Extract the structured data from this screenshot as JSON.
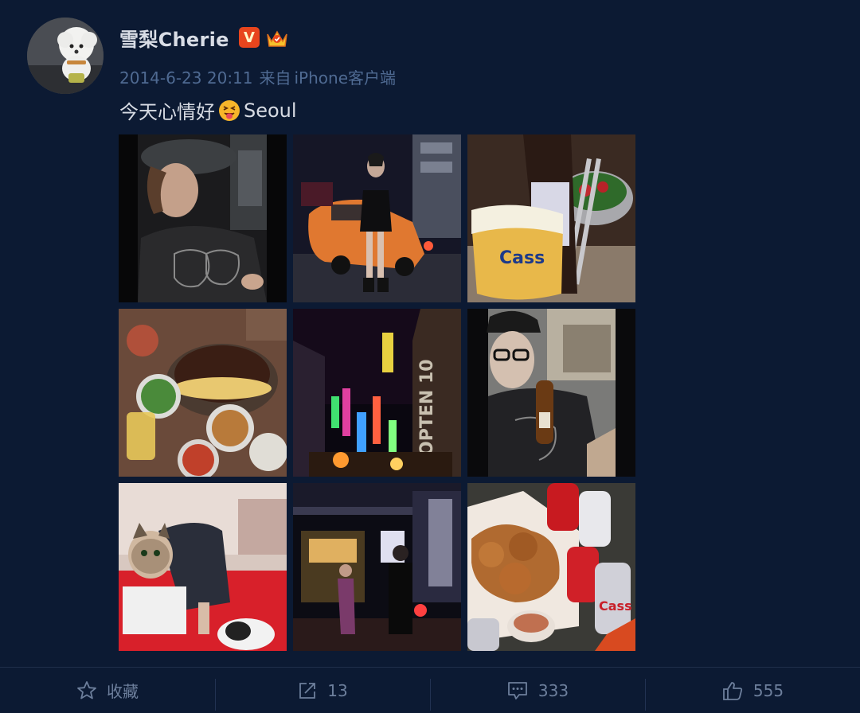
{
  "user": {
    "name": "雪梨Cherie",
    "verified_badge": "V",
    "member_badge": "crown-badge-icon"
  },
  "meta": {
    "datetime": "2014-6-23 20:11",
    "source_prefix": "来自",
    "source": "iPhone客户端"
  },
  "post": {
    "text_before": "今天心情好",
    "emoji": "tongue-out-emoji-icon",
    "text_after": "Seoul"
  },
  "photos": [
    {
      "name": "photo-girl-in-car",
      "alt": "girl in cap in car"
    },
    {
      "name": "photo-orange-taxi-street",
      "alt": "street with orange taxi"
    },
    {
      "name": "photo-cass-beer-salad",
      "alt": "cass beer and salad"
    },
    {
      "name": "photo-korean-bbq",
      "alt": "korean bbq table"
    },
    {
      "name": "photo-night-street-neon",
      "alt": "neon street at night"
    },
    {
      "name": "photo-selfie-beer",
      "alt": "selfie with beer bottle"
    },
    {
      "name": "photo-cat-face-sticker",
      "alt": "people with cat sticker"
    },
    {
      "name": "photo-shopping-street-night",
      "alt": "shopping street at night"
    },
    {
      "name": "photo-fried-chicken-cans",
      "alt": "fried chicken and beer cans"
    }
  ],
  "actions": {
    "favorite_label": "收藏",
    "repost_count": "13",
    "comment_count": "333",
    "like_count": "555"
  },
  "colors": {
    "background": "#0c1a33",
    "meta_text": "#4f6a92",
    "action_text": "#6d7f9c",
    "verified_badge": "#e8451d"
  }
}
